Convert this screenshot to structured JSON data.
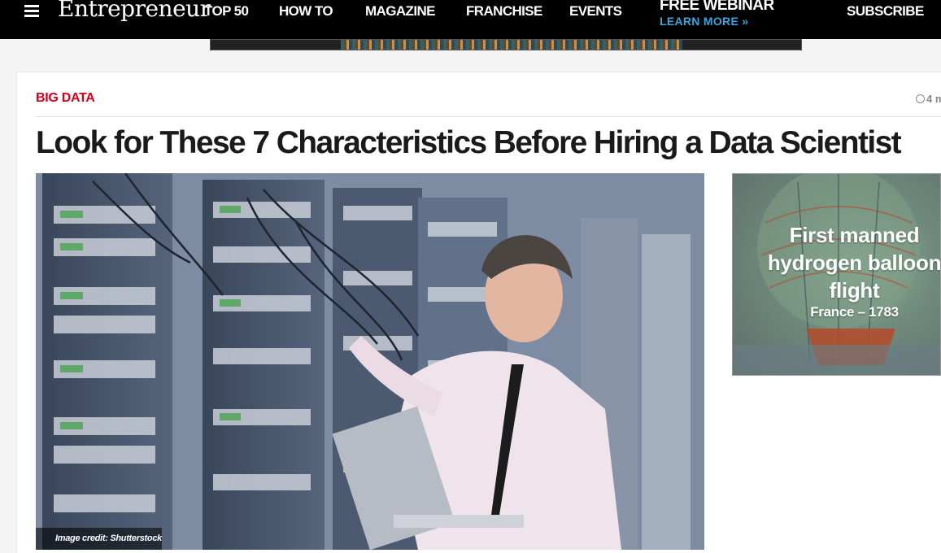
{
  "header": {
    "logo": "Entrepreneur",
    "nav": [
      "TOP 50",
      "HOW TO",
      "MAGAZINE",
      "FRANCHISE",
      "EVENTS"
    ],
    "webinar_title": "FREE WEBINAR",
    "webinar_cta": "LEARN MORE »",
    "subscribe": "SUBSCRIBE",
    "menu_icon": "hamburger-icon",
    "background": "#000000",
    "accent": "#39a6e0"
  },
  "article": {
    "category": "BIG DATA",
    "time": "4 m",
    "headline": "Look for These 7 Characteristics Before Hiring a Data Scientist",
    "image_credit": "Image credit: Shutterstock",
    "category_color": "#d0021b"
  },
  "side_ad": {
    "title": "First manned hydrogen balloon flight",
    "subtitle": "France – 1783"
  }
}
